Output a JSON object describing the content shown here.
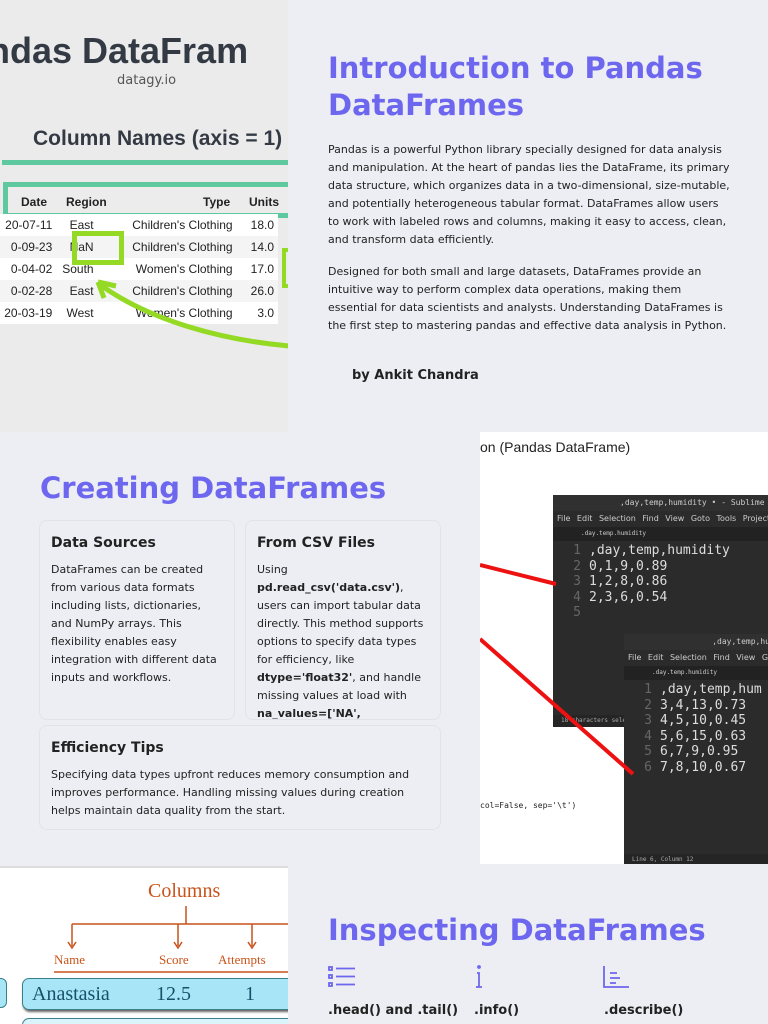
{
  "intro": {
    "title": "Introduction to Pandas DataFrames",
    "p1": "Pandas is a powerful Python library specially designed for data analysis and manipulation. At the heart of pandas lies the DataFrame, its primary data structure, which organizes data in a two-dimensional, size-mutable, and potentially heterogeneous tabular format. DataFrames allow users to work with labeled rows and columns, making it easy to access, clean, and transform data efficiently.",
    "p2": "Designed for both small and large datasets, DataFrames provide an intuitive way to perform complex data operations, making them essential for data scientists and analysts. Understanding DataFrames is the first step to mastering pandas and effective data analysis in Python.",
    "author": "by Ankit Chandra"
  },
  "image1": {
    "title": "ndas DataFram",
    "site": "datagy.io",
    "subtitle": "Column Names (axis = 1)",
    "headers": [
      "Date",
      "Region",
      "Type",
      "Units"
    ],
    "rows": [
      [
        "20-07-11",
        "East",
        "Children's Clothing",
        "18.0"
      ],
      [
        "0-09-23",
        "NaN",
        "Children's Clothing",
        "14.0"
      ],
      [
        "0-04-02",
        "South",
        "Women's Clothing",
        "17.0"
      ],
      [
        "0-02-28",
        "East",
        "Children's Clothing",
        "26.0"
      ],
      [
        "20-03-19",
        "West",
        "Women's Clothing",
        "3.0"
      ]
    ]
  },
  "creating": {
    "title": "Creating DataFrames",
    "cards": [
      {
        "title": "Data Sources",
        "text": "DataFrames can be created from various data formats including lists, dictionaries, and NumPy arrays. This flexibility enables easy integration with different data inputs and workflows."
      },
      {
        "title": "From CSV Files",
        "t1": "Using ",
        "c1": "pd.read_csv('data.csv')",
        "t2": ", users can import tabular data directly. This method supports options to specify data types for efficiency, like ",
        "c2": "dtype='float32'",
        "t3": ", and handle missing values at load with ",
        "c3": "na_values=['NA',"
      },
      {
        "title": "Efficiency Tips",
        "text": "Specifying data types upfront reduces memory consumption and improves performance. Handling missing values during creation helps maintain data quality from the start."
      }
    ]
  },
  "image2": {
    "caption": "on (Pandas DataFrame)",
    "code_snip": "col=False, sep='\\t')",
    "win1": {
      "title": ",day,temp,humidity • - Sublime Te",
      "menu": "File Edit Selection Find View Goto Tools Project",
      "tab": ".day.temp.humidity",
      "lines": [
        ",day,temp,humidity",
        "0,1,9,0.89",
        "1,2,8,0.86",
        "2,3,6,0.54",
        ""
      ],
      "status": "18 characters selec"
    },
    "win2": {
      "title": ",day,temp,hu",
      "menu": "File Edit Selection Find View G",
      "tab": ".day.temp.humidity",
      "lines": [
        ",day,temp,hum",
        "3,4,13,0.73",
        "4,5,10,0.45",
        "5,6,15,0.63",
        "6,7,9,0.95",
        "7,8,10,0.67"
      ],
      "status": "Line 6, Column 12"
    }
  },
  "image3": {
    "title": "Columns",
    "headers": [
      "Name",
      "Score",
      "Attempts"
    ],
    "row": [
      "Anastasia",
      "12.5",
      "1"
    ]
  },
  "inspecting": {
    "title": "Inspecting DataFrames",
    "items": [
      {
        "label": ".head() and .tail()",
        "icon": "list-icon"
      },
      {
        "label": ".info()",
        "icon": "info-icon"
      },
      {
        "label": ".describe()",
        "icon": "chart-icon"
      }
    ]
  },
  "colors": {
    "accent": "#6d66ee",
    "green": "#5ec89f",
    "lime": "#94d923",
    "red": "#ee1111"
  }
}
